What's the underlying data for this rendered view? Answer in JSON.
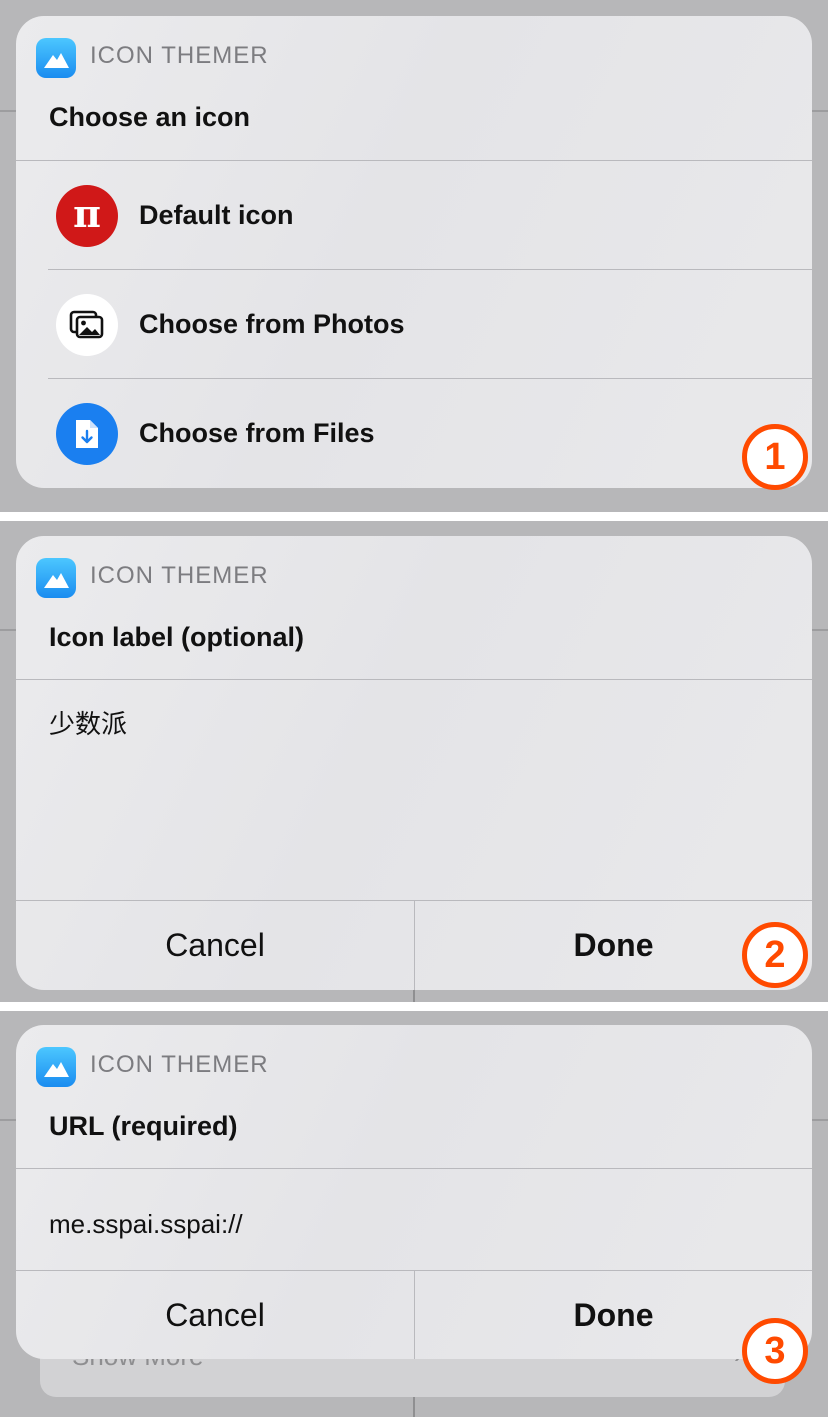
{
  "app": {
    "name": "ICON THEMER"
  },
  "step1": {
    "prompt": "Choose an icon",
    "options": [
      {
        "label": "Default icon",
        "icon": "pi-icon",
        "color": "#d01818"
      },
      {
        "label": "Choose from Photos",
        "icon": "photos-icon",
        "color": "#ffffff"
      },
      {
        "label": "Choose from Files",
        "icon": "files-icon",
        "color": "#1a7ff0"
      }
    ],
    "badge": "1"
  },
  "step2": {
    "prompt": "Icon label (optional)",
    "value": "少数派",
    "cancel_label": "Cancel",
    "done_label": "Done",
    "badge": "2"
  },
  "step3": {
    "prompt": "URL (required)",
    "value": "me.sspai.sspai://",
    "cancel_label": "Cancel",
    "done_label": "Done",
    "badge": "3",
    "background_row_label": "Show More"
  },
  "colors": {
    "accent_badge": "#ff4a00",
    "app_icon": "#2aa8f8"
  }
}
